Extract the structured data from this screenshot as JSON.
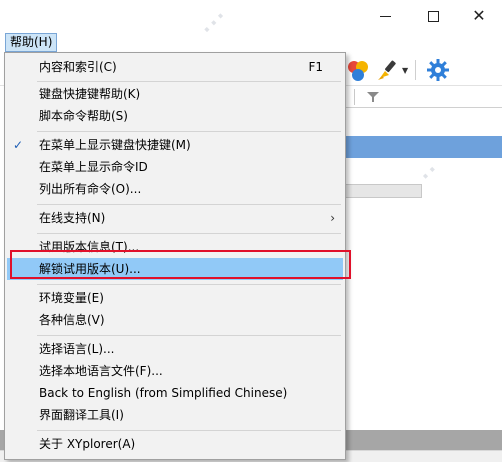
{
  "window": {
    "minimize_icon": "minimize-icon",
    "maximize_icon": "maximize-icon",
    "close_icon": "close-icon",
    "close_glyph": "✕"
  },
  "menubar": {
    "help_label": "帮助(H)"
  },
  "toolbar": {
    "icons": [
      "color-balls-icon",
      "brush-icon",
      "gear-icon"
    ],
    "colors": {
      "red": "#e8483a",
      "yellow": "#f5b400",
      "blue": "#2f7fd9",
      "gear": "#2f7fd9"
    }
  },
  "colors": {
    "highlight": "#91c9f7",
    "menu_bg": "#f2f2f2",
    "annotation_red": "#e0102a",
    "selection_blue": "#6ea1dc",
    "check_blue": "#1f5fb5"
  },
  "help_menu": {
    "items": [
      {
        "label": "内容和索引(C)",
        "shortcut": "F1"
      },
      {
        "label": "键盘快捷键帮助(K)"
      },
      {
        "label": "脚本命令帮助(S)"
      },
      {
        "label": "在菜单上显示键盘快捷键(M)",
        "checked": true
      },
      {
        "label": "在菜单上显示命令ID"
      },
      {
        "label": "列出所有命令(O)..."
      },
      {
        "label": "在线支持(N)",
        "submenu": true,
        "arrow": "›"
      },
      {
        "label": "试用版本信息(T)..."
      },
      {
        "label": "解锁试用版本(U)...",
        "highlighted": true
      },
      {
        "label": "环境变量(E)"
      },
      {
        "label": "各种信息(V)"
      },
      {
        "label": "选择语言(L)..."
      },
      {
        "label": "选择本地语言文件(F)..."
      },
      {
        "label": "Back to English (from Simplified Chinese)"
      },
      {
        "label": "界面翻译工具(I)"
      },
      {
        "label": "关于 XYplorer(A)"
      }
    ],
    "check_glyph": "✓"
  }
}
